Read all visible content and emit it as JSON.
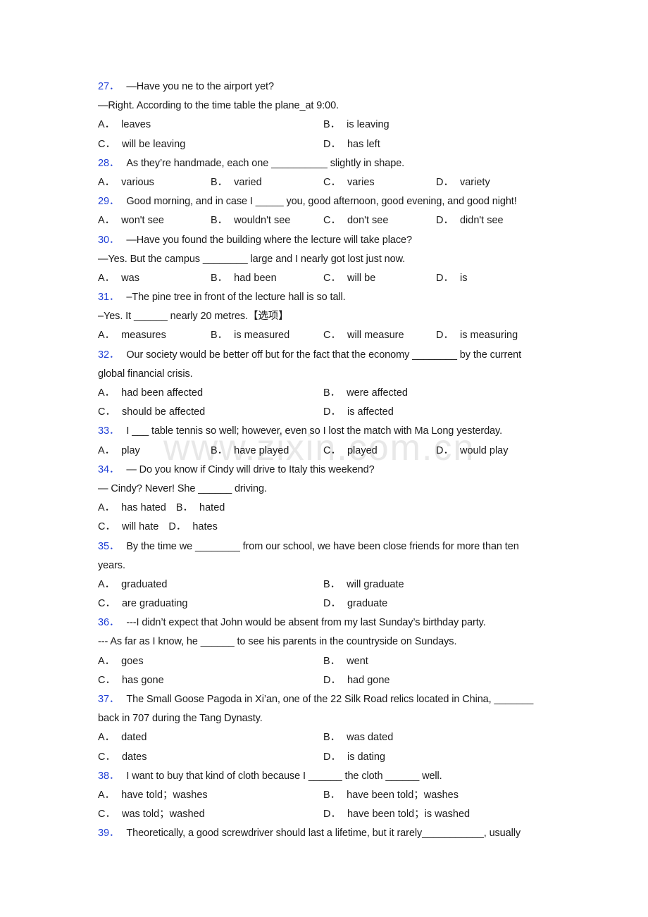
{
  "watermark": "www.zixin.com.cn",
  "questions": [
    {
      "number": "27．",
      "stem": [
        "—Have you ne to the airport yet?",
        "—Right. According to the time table the plane_at 9:00."
      ],
      "layout": "two",
      "options": [
        {
          "letter": "A．",
          "text": "leaves"
        },
        {
          "letter": "B．",
          "text": "is leaving"
        },
        {
          "letter": "C．",
          "text": "will be leaving"
        },
        {
          "letter": "D．",
          "text": "has left"
        }
      ]
    },
    {
      "number": "28．",
      "stem": [
        "As they’re handmade, each one __________ slightly in shape."
      ],
      "layout": "four",
      "options": [
        {
          "letter": "A．",
          "text": "various"
        },
        {
          "letter": "B．",
          "text": "varied"
        },
        {
          "letter": "C．",
          "text": "varies"
        },
        {
          "letter": "D．",
          "text": "variety"
        }
      ]
    },
    {
      "number": "29．",
      "stem": [
        "Good morning, and in case I _____ you, good afternoon, good evening, and good night!"
      ],
      "layout": "four",
      "options": [
        {
          "letter": "A．",
          "text": "won't see"
        },
        {
          "letter": "B．",
          "text": "wouldn't see"
        },
        {
          "letter": "C．",
          "text": "don't see"
        },
        {
          "letter": "D．",
          "text": "didn't see"
        }
      ]
    },
    {
      "number": "30．",
      "stem": [
        "—Have you found the building where the lecture will take place?",
        "—Yes. But the campus ________ large and I nearly got lost just now."
      ],
      "layout": "four",
      "options": [
        {
          "letter": "A．",
          "text": "was"
        },
        {
          "letter": "B．",
          "text": "had been"
        },
        {
          "letter": "C．",
          "text": "will be"
        },
        {
          "letter": "D．",
          "text": "is"
        }
      ]
    },
    {
      "number": "31．",
      "stem": [
        "–The pine tree in front of the lecture hall is so tall.",
        "–Yes. It ______ nearly 20 metres.【选项】"
      ],
      "layout": "four",
      "options": [
        {
          "letter": "A．",
          "text": "measures"
        },
        {
          "letter": "B．",
          "text": "is measured"
        },
        {
          "letter": "C．",
          "text": "will measure"
        },
        {
          "letter": "D．",
          "text": "is measuring"
        }
      ]
    },
    {
      "number": "32．",
      "stem": [
        "Our society would be better off but for the fact that the economy ________ by the current",
        "global financial crisis."
      ],
      "layout": "two",
      "options": [
        {
          "letter": "A．",
          "text": "had been affected"
        },
        {
          "letter": "B．",
          "text": "were affected"
        },
        {
          "letter": "C．",
          "text": "should be affected"
        },
        {
          "letter": "D．",
          "text": "is affected"
        }
      ]
    },
    {
      "number": "33．",
      "stem": [
        "I ___ table tennis so well; however, even so I lost the match with Ma Long yesterday."
      ],
      "layout": "four",
      "options": [
        {
          "letter": "A．",
          "text": "play"
        },
        {
          "letter": "B．",
          "text": "have played"
        },
        {
          "letter": "C．",
          "text": "played"
        },
        {
          "letter": "D．",
          "text": "would play"
        }
      ]
    },
    {
      "number": "34．",
      "stem": [
        "— Do you know if Cindy will drive to Italy this weekend?",
        "— Cindy? Never! She ______ driving."
      ],
      "layout": "inline",
      "options": [
        {
          "letter": "A．",
          "text": "has hated"
        },
        {
          "letter": "B．",
          "text": "hated"
        },
        {
          "letter": "C．",
          "text": "will hate"
        },
        {
          "letter": "D．",
          "text": "hates"
        }
      ]
    },
    {
      "number": "35．",
      "stem": [
        "By the time we ________ from our school, we have been close friends for more than ten",
        "years."
      ],
      "layout": "two",
      "options": [
        {
          "letter": "A．",
          "text": "graduated"
        },
        {
          "letter": "B．",
          "text": "will graduate"
        },
        {
          "letter": "C．",
          "text": "are graduating"
        },
        {
          "letter": "D．",
          "text": "graduate"
        }
      ]
    },
    {
      "number": "36．",
      "stem": [
        "---I didn’t expect that John would be absent from my last Sunday’s birthday party.",
        "--- As far as I know, he ______ to see his parents in the countryside on Sundays."
      ],
      "layout": "two",
      "options": [
        {
          "letter": "A．",
          "text": "goes"
        },
        {
          "letter": "B．",
          "text": "went"
        },
        {
          "letter": "C．",
          "text": "has gone"
        },
        {
          "letter": "D．",
          "text": "had gone"
        }
      ]
    },
    {
      "number": "37．",
      "stem": [
        "The Small Goose Pagoda in Xi’an, one of the 22 Silk Road relics located in China, _______",
        "back in 707 during the Tang Dynasty."
      ],
      "layout": "two",
      "options": [
        {
          "letter": "A．",
          "text": "dated"
        },
        {
          "letter": "B．",
          "text": "was dated"
        },
        {
          "letter": "C．",
          "text": "dates"
        },
        {
          "letter": "D．",
          "text": "is dating"
        }
      ]
    },
    {
      "number": "38．",
      "stem": [
        "I want to buy that kind of cloth because I ______ the cloth ______ well."
      ],
      "layout": "two",
      "options": [
        {
          "letter": "A．",
          "text": "have told；washes"
        },
        {
          "letter": "B．",
          "text": "have been told；washes"
        },
        {
          "letter": "C．",
          "text": "was told；washed"
        },
        {
          "letter": "D．",
          "text": "have been told；is washed"
        }
      ]
    },
    {
      "number": "39．",
      "stem": [
        "Theoretically, a good screwdriver should last a lifetime, but it rarely___________, usually"
      ],
      "layout": "none",
      "options": []
    }
  ]
}
